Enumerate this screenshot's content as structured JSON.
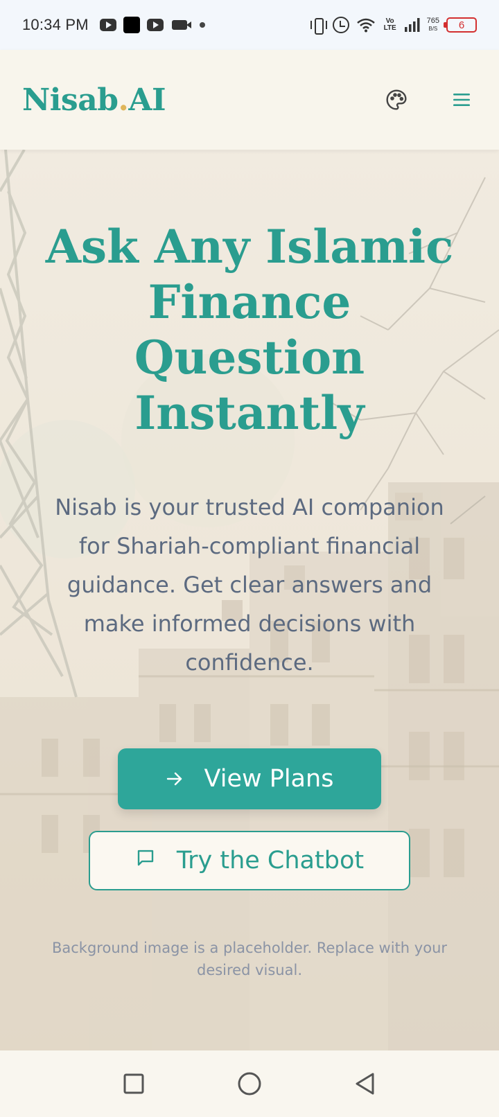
{
  "status_bar": {
    "time": "10:34 PM",
    "network_label": "Vo LTE",
    "speed_value": "765",
    "speed_unit": "B/S",
    "battery_level": "6"
  },
  "header": {
    "logo_part1": "Nisab",
    "logo_dot": ".",
    "logo_part2": "AI"
  },
  "hero": {
    "title": "Ask Any Islamic Finance Question Instantly",
    "subtitle": "Nisab is your trusted AI companion for Shariah-compliant financial guidance. Get clear answers and make informed decisions with confidence.",
    "primary_button": "View Plans",
    "secondary_button": "Try the Chatbot",
    "note": "Background image is a placeholder. Replace with your desired visual."
  },
  "colors": {
    "brand_teal": "#2a9d8f",
    "button_teal": "#2ea69a",
    "logo_dot": "#e0b65a",
    "battery_low": "#d32f2f"
  },
  "icons": {
    "palette": "palette-icon",
    "menu": "hamburger-menu-icon",
    "arrow": "arrow-right-icon",
    "chat": "chat-bubble-icon",
    "nav_recent": "square-icon",
    "nav_home": "circle-icon",
    "nav_back": "triangle-back-icon"
  }
}
